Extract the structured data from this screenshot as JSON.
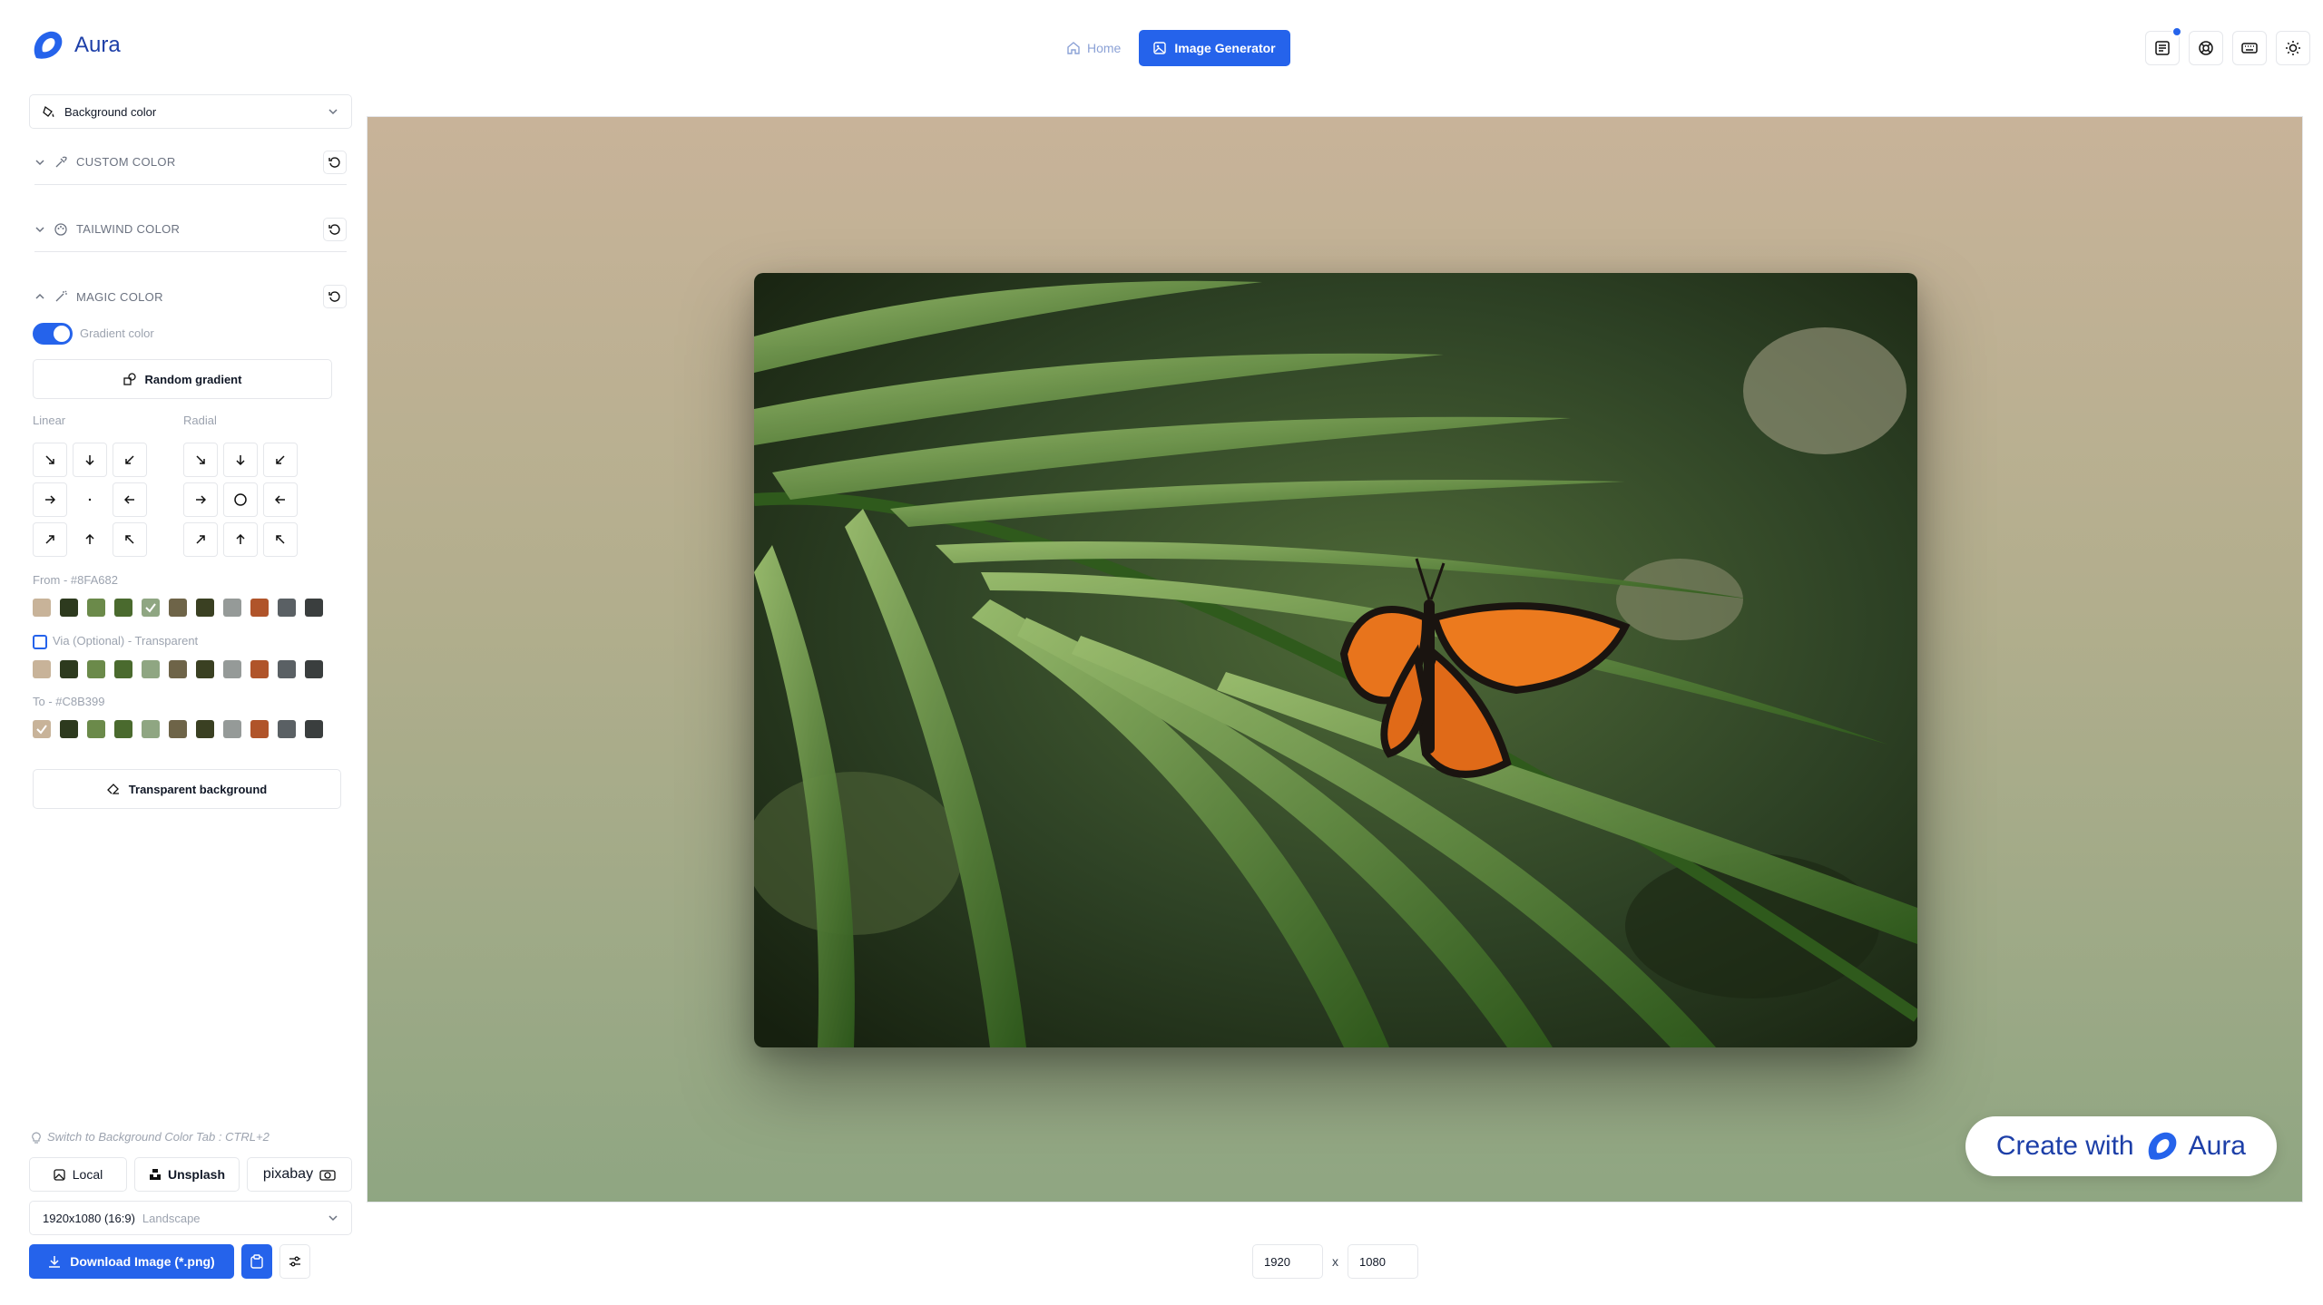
{
  "app": {
    "name": "Aura"
  },
  "nav": {
    "home": "Home",
    "active": "Image Generator"
  },
  "header_icons": [
    "news-icon",
    "support-icon",
    "keyboard-icon",
    "sun-icon"
  ],
  "sidebar": {
    "mode_select": "Background color",
    "sections": {
      "custom": "CUSTOM COLOR",
      "tailwind": "TAILWIND COLOR",
      "magic": "MAGIC COLOR"
    },
    "gradient_toggle": "Gradient color",
    "random_gradient": "Random gradient",
    "linear_label": "Linear",
    "radial_label": "Radial",
    "from_label": "From - #8FA682",
    "via_label": "Via (Optional) - Transparent",
    "to_label": "To - #C8B399",
    "palette": [
      "#c8b399",
      "#2d3a1e",
      "#6b8a4a",
      "#4a6a2e",
      "#8fa682",
      "#6e6448",
      "#3a4022",
      "#959a98",
      "#b0542a",
      "#5a6064",
      "#3a3e3e"
    ],
    "transparent_bg": "Transparent background",
    "hint": "Switch to Background Color Tab : CTRL+2",
    "sources": {
      "local": "Local",
      "unsplash": "Unsplash",
      "pixabay": "pixabay"
    },
    "resolution": "1920x1080 (16:9)",
    "orientation": "Landscape",
    "download": "Download Image (*.png)"
  },
  "canvas": {
    "gradient_from": "#8FA682",
    "gradient_to": "#C8B399",
    "watermark": "Create with",
    "watermark_brand": "Aura"
  },
  "size": {
    "width": "1920",
    "height": "1080",
    "separator": "x"
  }
}
